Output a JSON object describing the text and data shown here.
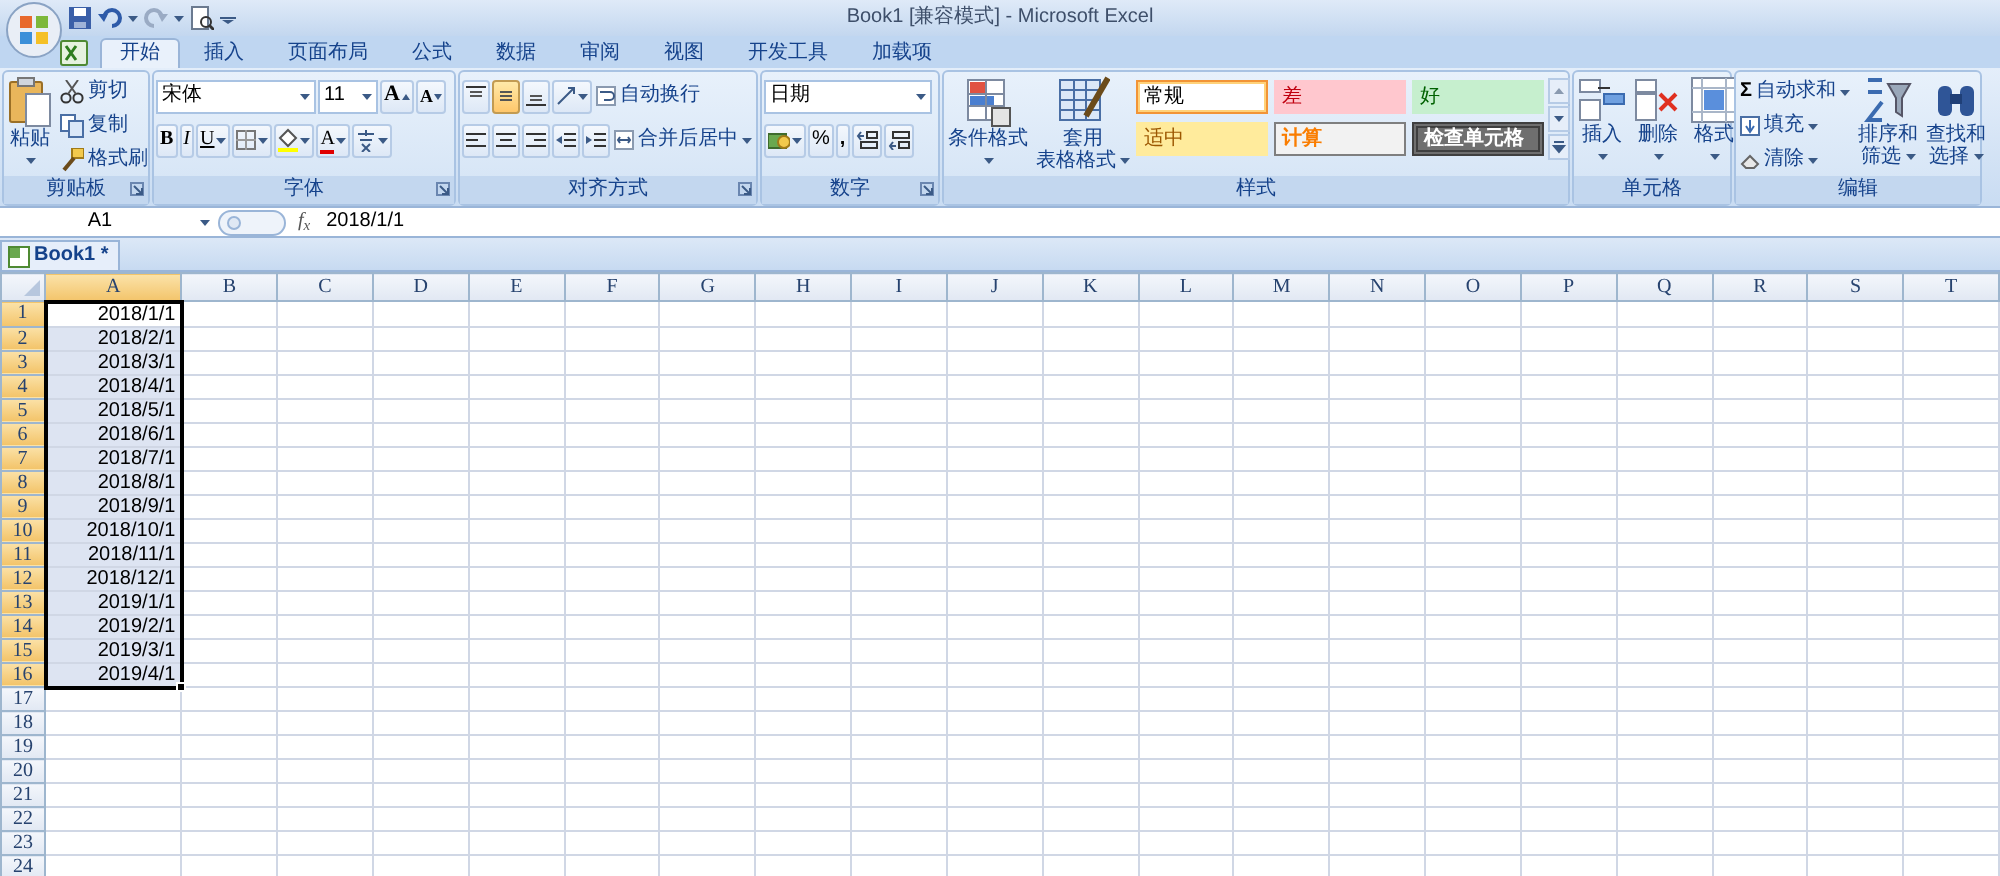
{
  "window": {
    "title": "Book1  [兼容模式] - Microsoft Excel"
  },
  "tabs": [
    {
      "label": "开始",
      "selected": true
    },
    {
      "label": "插入",
      "selected": false
    },
    {
      "label": "页面布局",
      "selected": false
    },
    {
      "label": "公式",
      "selected": false
    },
    {
      "label": "数据",
      "selected": false
    },
    {
      "label": "审阅",
      "selected": false
    },
    {
      "label": "视图",
      "selected": false
    },
    {
      "label": "开发工具",
      "selected": false
    },
    {
      "label": "加载项",
      "selected": false
    }
  ],
  "ribbon": {
    "clipboard": {
      "label": "剪贴板",
      "paste": "粘贴",
      "cut": "剪切",
      "copy": "复制",
      "format_painter": "格式刷"
    },
    "font": {
      "label": "字体",
      "font_name": "宋体",
      "font_size": "11",
      "grow": "A",
      "shrink": "A",
      "bold": "B",
      "italic": "I",
      "underline": "U",
      "font_color": "A"
    },
    "alignment": {
      "label": "对齐方式",
      "vertical": [
        {
          "selected": false
        },
        {
          "selected": true
        },
        {
          "selected": false
        }
      ],
      "wrap_text": "自动换行",
      "merge_center": "合并后居中"
    },
    "number": {
      "label": "数字",
      "format": "日期",
      "percent": "%",
      "comma": ","
    },
    "styles": {
      "label": "样式",
      "conditional": "条件格式",
      "table_lines": [
        "套用",
        "表格格式"
      ],
      "cell_styles": [
        {
          "label": "常规",
          "kind": "normal",
          "selected": true
        },
        {
          "label": "差",
          "kind": "bad",
          "selected": false
        },
        {
          "label": "好",
          "kind": "good",
          "selected": false
        },
        {
          "label": "适中",
          "kind": "neutral",
          "selected": false
        },
        {
          "label": "计算",
          "kind": "calculation",
          "selected": false
        },
        {
          "label": "检查单元格",
          "kind": "check",
          "selected": false
        }
      ]
    },
    "cells": {
      "label": "单元格",
      "buttons": [
        "插入",
        "删除",
        "格式"
      ]
    },
    "editing": {
      "label": "编辑",
      "sum_symbol": "Σ",
      "autosum": "自动求和",
      "fill": "填充",
      "clear": "清除",
      "sort_lines": [
        "排序和",
        "筛选"
      ],
      "find_lines": [
        "查找和",
        "选择"
      ]
    }
  },
  "formula_bar": {
    "name_box": "A1",
    "function_label": "f$_{x}$",
    "formula": "2018/1/1"
  },
  "workbook_tab": {
    "label": "Book1 *"
  },
  "sheet": {
    "columns": [
      {
        "label": "A",
        "selected": true
      },
      {
        "label": "B",
        "selected": false
      },
      {
        "label": "C",
        "selected": false
      },
      {
        "label": "D",
        "selected": false
      },
      {
        "label": "E",
        "selected": false
      },
      {
        "label": "F",
        "selected": false
      },
      {
        "label": "G",
        "selected": false
      },
      {
        "label": "H",
        "selected": false
      },
      {
        "label": "I",
        "selected": false
      },
      {
        "label": "J",
        "selected": false
      },
      {
        "label": "K",
        "selected": false
      },
      {
        "label": "L",
        "selected": false
      },
      {
        "label": "M",
        "selected": false
      },
      {
        "label": "N",
        "selected": false
      },
      {
        "label": "O",
        "selected": false
      },
      {
        "label": "P",
        "selected": false
      },
      {
        "label": "Q",
        "selected": false
      },
      {
        "label": "R",
        "selected": false
      },
      {
        "label": "S",
        "selected": false
      },
      {
        "label": "T",
        "selected": false
      }
    ],
    "rows": [
      {
        "label": "1",
        "selected": true,
        "cells": [
          {
            "text": "2018/1/1",
            "active": true
          }
        ]
      },
      {
        "label": "2",
        "selected": true,
        "cells": [
          {
            "text": "2018/2/1",
            "active": false
          }
        ]
      },
      {
        "label": "3",
        "selected": true,
        "cells": [
          {
            "text": "2018/3/1",
            "active": false
          }
        ]
      },
      {
        "label": "4",
        "selected": true,
        "cells": [
          {
            "text": "2018/4/1",
            "active": false
          }
        ]
      },
      {
        "label": "5",
        "selected": true,
        "cells": [
          {
            "text": "2018/5/1",
            "active": false
          }
        ]
      },
      {
        "label": "6",
        "selected": true,
        "cells": [
          {
            "text": "2018/6/1",
            "active": false
          }
        ]
      },
      {
        "label": "7",
        "selected": true,
        "cells": [
          {
            "text": "2018/7/1",
            "active": false
          }
        ]
      },
      {
        "label": "8",
        "selected": true,
        "cells": [
          {
            "text": "2018/8/1",
            "active": false
          }
        ]
      },
      {
        "label": "9",
        "selected": true,
        "cells": [
          {
            "text": "2018/9/1",
            "active": false
          }
        ]
      },
      {
        "label": "10",
        "selected": true,
        "cells": [
          {
            "text": "2018/10/1",
            "active": false
          }
        ]
      },
      {
        "label": "11",
        "selected": true,
        "cells": [
          {
            "text": "2018/11/1",
            "active": false
          }
        ]
      },
      {
        "label": "12",
        "selected": true,
        "cells": [
          {
            "text": "2018/12/1",
            "active": false
          }
        ]
      },
      {
        "label": "13",
        "selected": true,
        "cells": [
          {
            "text": "2019/1/1",
            "active": false
          }
        ]
      },
      {
        "label": "14",
        "selected": true,
        "cells": [
          {
            "text": "2019/2/1",
            "active": false
          }
        ]
      },
      {
        "label": "15",
        "selected": true,
        "cells": [
          {
            "text": "2019/3/1",
            "active": false
          }
        ]
      },
      {
        "label": "16",
        "selected": true,
        "cells": [
          {
            "text": "2019/4/1",
            "active": false
          }
        ]
      },
      {
        "label": "17",
        "selected": false
      },
      {
        "label": "18",
        "selected": false
      },
      {
        "label": "19",
        "selected": false
      },
      {
        "label": "20",
        "selected": false
      },
      {
        "label": "21",
        "selected": false
      },
      {
        "label": "22",
        "selected": false
      },
      {
        "label": "23",
        "selected": false
      },
      {
        "label": "24",
        "selected": false
      }
    ]
  }
}
